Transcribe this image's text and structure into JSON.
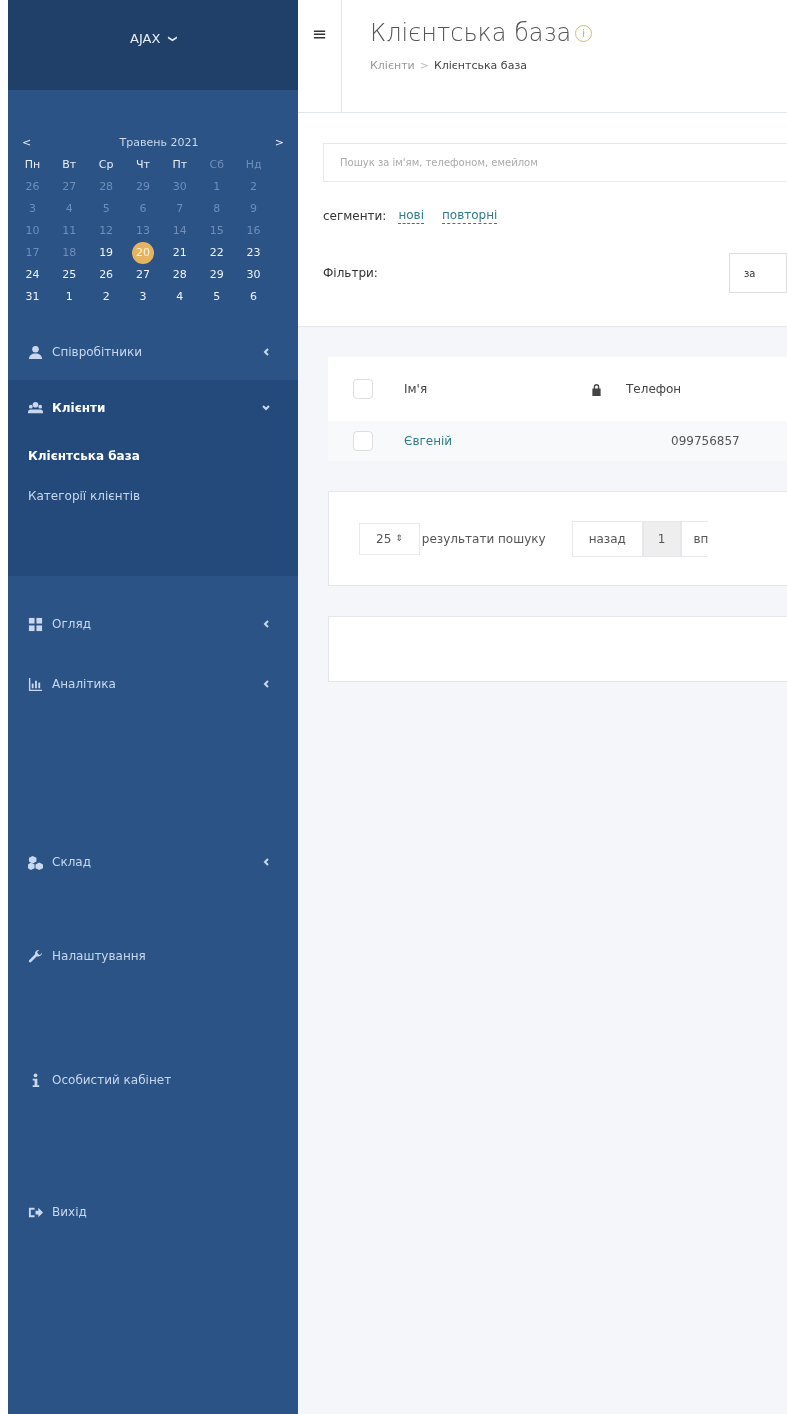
{
  "sidebar": {
    "brand": "AJAX",
    "brand_caret": "❯",
    "calendar": {
      "prev": "<",
      "next": ">",
      "month": "Травень 2021",
      "weekdays": [
        {
          "label": "Пн",
          "muted": false
        },
        {
          "label": "Вт",
          "muted": false
        },
        {
          "label": "Ср",
          "muted": false
        },
        {
          "label": "Чт",
          "muted": false
        },
        {
          "label": "Пт",
          "muted": false
        },
        {
          "label": "Сб",
          "muted": true
        },
        {
          "label": "Нд",
          "muted": true
        }
      ],
      "weeks": [
        [
          {
            "label": "26",
            "muted": true,
            "selected": false
          },
          {
            "label": "27",
            "muted": true,
            "selected": false
          },
          {
            "label": "28",
            "muted": true,
            "selected": false
          },
          {
            "label": "29",
            "muted": true,
            "selected": false
          },
          {
            "label": "30",
            "muted": true,
            "selected": false
          },
          {
            "label": "1",
            "muted": true,
            "selected": false
          },
          {
            "label": "2",
            "muted": true,
            "selected": false
          }
        ],
        [
          {
            "label": "3",
            "muted": true,
            "selected": false
          },
          {
            "label": "4",
            "muted": true,
            "selected": false
          },
          {
            "label": "5",
            "muted": true,
            "selected": false
          },
          {
            "label": "6",
            "muted": true,
            "selected": false
          },
          {
            "label": "7",
            "muted": true,
            "selected": false
          },
          {
            "label": "8",
            "muted": true,
            "selected": false
          },
          {
            "label": "9",
            "muted": true,
            "selected": false
          }
        ],
        [
          {
            "label": "10",
            "muted": true,
            "selected": false
          },
          {
            "label": "11",
            "muted": true,
            "selected": false
          },
          {
            "label": "12",
            "muted": true,
            "selected": false
          },
          {
            "label": "13",
            "muted": true,
            "selected": false
          },
          {
            "label": "14",
            "muted": true,
            "selected": false
          },
          {
            "label": "15",
            "muted": true,
            "selected": false
          },
          {
            "label": "16",
            "muted": true,
            "selected": false
          }
        ],
        [
          {
            "label": "17",
            "muted": true,
            "selected": false
          },
          {
            "label": "18",
            "muted": true,
            "selected": false
          },
          {
            "label": "19",
            "muted": false,
            "selected": false
          },
          {
            "label": "20",
            "muted": false,
            "selected": true
          },
          {
            "label": "21",
            "muted": false,
            "selected": false
          },
          {
            "label": "22",
            "muted": false,
            "selected": false
          },
          {
            "label": "23",
            "muted": false,
            "selected": false
          }
        ],
        [
          {
            "label": "24",
            "muted": false,
            "selected": false
          },
          {
            "label": "25",
            "muted": false,
            "selected": false
          },
          {
            "label": "26",
            "muted": false,
            "selected": false
          },
          {
            "label": "27",
            "muted": false,
            "selected": false
          },
          {
            "label": "28",
            "muted": false,
            "selected": false
          },
          {
            "label": "29",
            "muted": false,
            "selected": false
          },
          {
            "label": "30",
            "muted": false,
            "selected": false
          }
        ],
        [
          {
            "label": "31",
            "muted": false,
            "selected": false
          },
          {
            "label": "1",
            "muted": false,
            "selected": false
          },
          {
            "label": "2",
            "muted": false,
            "selected": false
          },
          {
            "label": "3",
            "muted": false,
            "selected": false
          },
          {
            "label": "4",
            "muted": false,
            "selected": false
          },
          {
            "label": "5",
            "muted": false,
            "selected": false
          },
          {
            "label": "6",
            "muted": false,
            "selected": false
          }
        ]
      ]
    },
    "items": [
      {
        "label": "Співробітники",
        "kind": "user",
        "expandable": true,
        "expanded": false
      },
      {
        "label": "Клієнти",
        "kind": "users",
        "expandable": true,
        "expanded": true,
        "children": [
          {
            "label": "Клієнтська база",
            "selected": true
          },
          {
            "label": "Категорії клієнтів",
            "selected": false
          }
        ]
      },
      {
        "label": "Огляд",
        "kind": "grid",
        "expandable": true,
        "expanded": false
      },
      {
        "label": "Аналітика",
        "kind": "chart",
        "expandable": true,
        "expanded": false
      },
      {
        "label": "Склад",
        "kind": "cubes",
        "expandable": true,
        "expanded": false
      },
      {
        "label": "Налаштування",
        "kind": "wrench",
        "expandable": false,
        "expanded": false
      },
      {
        "label": "Особистий кабінет",
        "kind": "info",
        "expandable": false,
        "expanded": false
      },
      {
        "label": "Вихід",
        "kind": "signout",
        "expandable": false,
        "expanded": false
      }
    ]
  },
  "header": {
    "menu": "≡",
    "title": "Клієнтська база",
    "info": "i",
    "breadcrumb": [
      "Клієнти",
      "Клієнтська база"
    ],
    "separator": ">"
  },
  "search": {
    "placeholder": "Пошук за ім'ям, телефоном, емейлом"
  },
  "segments": {
    "label": "сегменти:",
    "links": [
      "нові",
      "повторні"
    ]
  },
  "filters": {
    "label": "Фільтри:",
    "select": "за"
  },
  "table": {
    "select_all_checked": false,
    "columns": [
      {
        "label": "Ім'я",
        "lock": true
      },
      {
        "label": "Телефон",
        "lock": false
      }
    ],
    "rows": [
      {
        "checked": false,
        "cells": [
          "Євгеній",
          "099756857"
        ]
      }
    ]
  },
  "pagination": {
    "page_size": "25",
    "page_size_arrow": "⇕",
    "page_size_label": "результати пошуку",
    "prev": "назад",
    "pages": [
      {
        "label": "1",
        "selected": true
      }
    ],
    "next": "вп"
  }
}
